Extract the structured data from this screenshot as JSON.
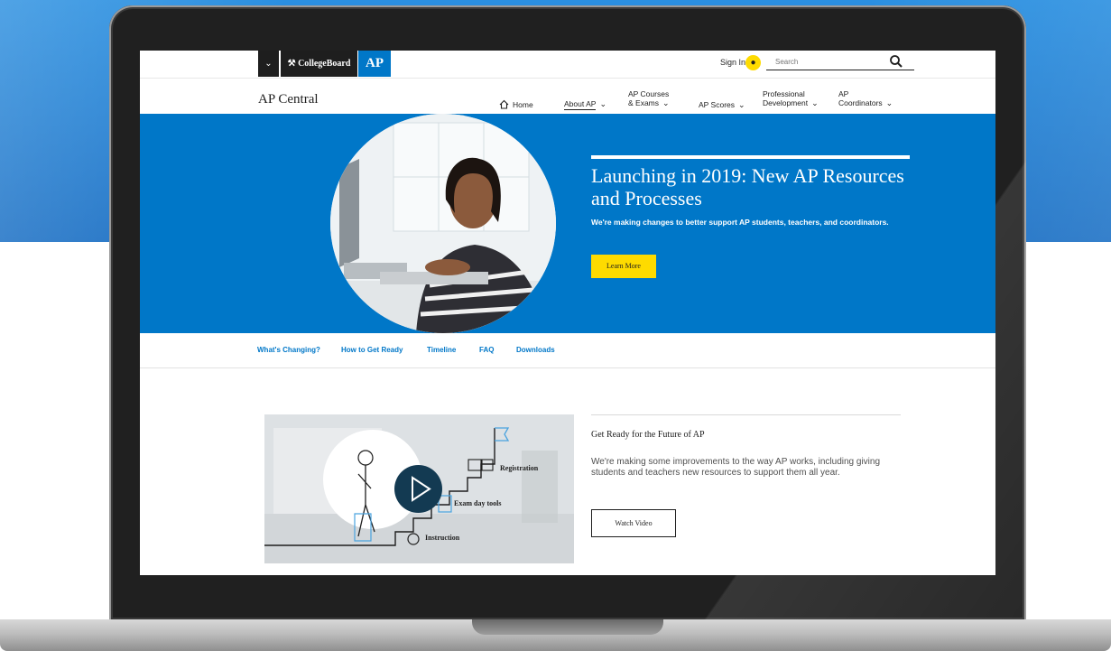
{
  "colors": {
    "brand_blue": "#0077c8",
    "yellow": "#fedb00",
    "dark": "#1e1e1e"
  },
  "topbar": {
    "menu_icon": "chevron-down-icon",
    "collegeboard_logo": "CollegeBoard",
    "ap_logo": "AP",
    "signin_label": "Sign In",
    "avatar_icon": "user-icon",
    "search_placeholder": "Search",
    "search_icon": "search-icon"
  },
  "nav": {
    "site_title": "AP Central",
    "items": [
      {
        "label": "Home",
        "icon": "home-icon"
      },
      {
        "label": "About AP"
      },
      {
        "label_line1": "AP Courses",
        "label_line2": "& Exams"
      },
      {
        "label": "AP Scores"
      },
      {
        "label_line1": "Professional",
        "label_line2": "Development"
      },
      {
        "label_line1": "AP",
        "label_line2": "Coordinators"
      }
    ]
  },
  "hero": {
    "title": "Launching in 2019: New AP Resources and Processes",
    "subtitle": "We're making changes to better support AP students, teachers, and coordinators.",
    "cta": "Learn More"
  },
  "subnav": [
    "What's Changing?",
    "How to Get Ready",
    "Timeline",
    "FAQ",
    "Downloads"
  ],
  "feature": {
    "illustration_labels": [
      "Registration",
      "Exam day tools",
      "Instruction"
    ],
    "title": "Get Ready for the Future of AP",
    "text": "We're making some improvements to the way AP works, including giving students and teachers new resources to support them all year.",
    "button": "Watch Video"
  }
}
